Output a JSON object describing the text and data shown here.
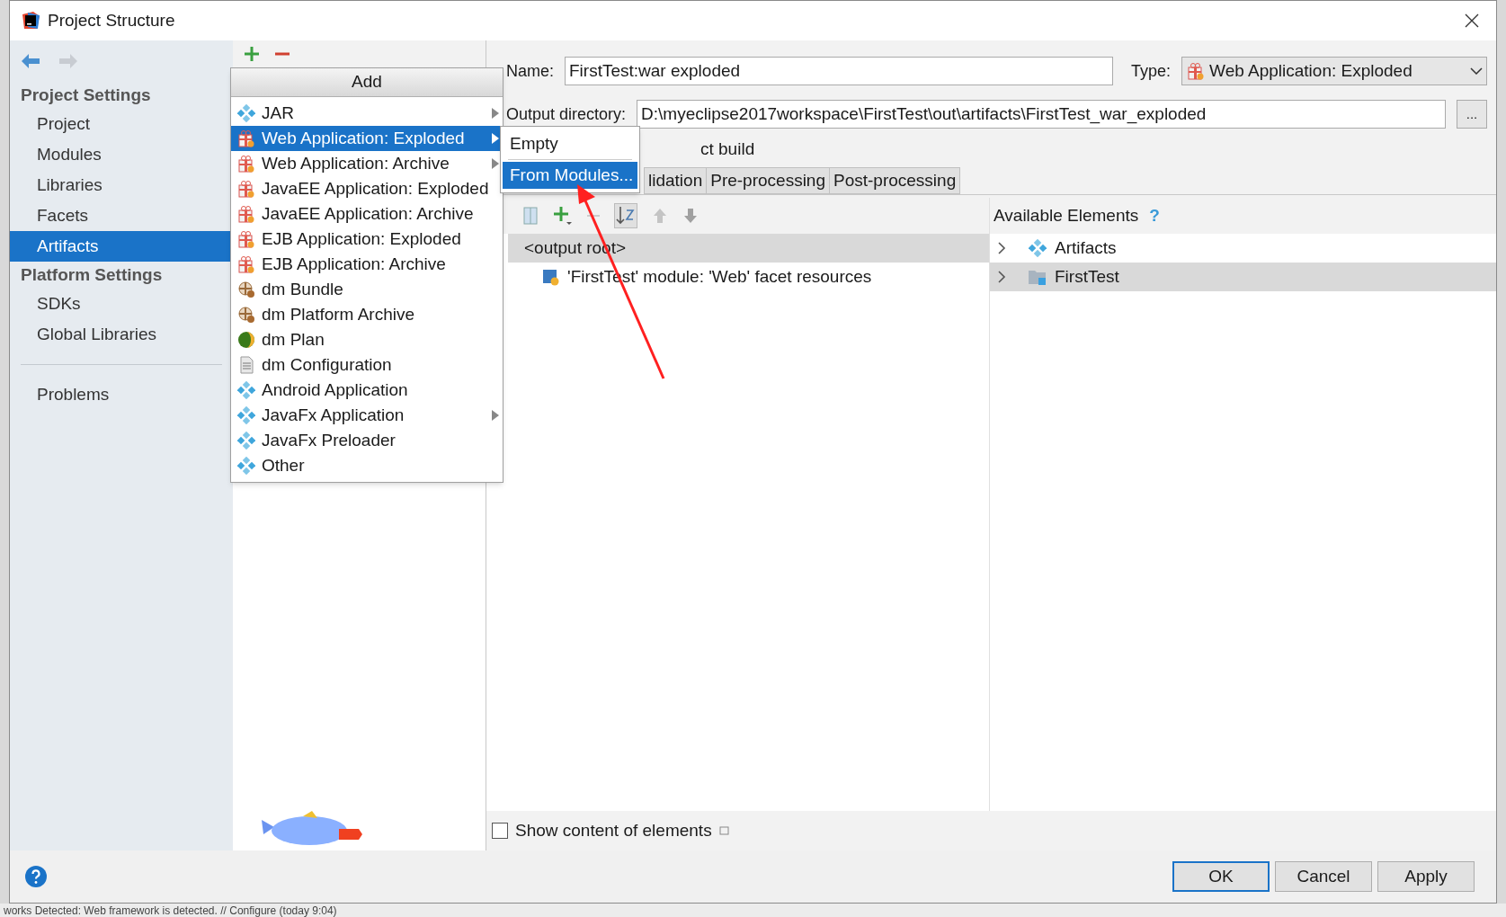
{
  "window": {
    "title": "Project Structure"
  },
  "sidebar": {
    "sections": [
      {
        "heading": "Project Settings",
        "items": [
          {
            "label": "Project",
            "selected": false
          },
          {
            "label": "Modules",
            "selected": false
          },
          {
            "label": "Libraries",
            "selected": false
          },
          {
            "label": "Facets",
            "selected": false
          },
          {
            "label": "Artifacts",
            "selected": true
          }
        ]
      },
      {
        "heading": "Platform Settings",
        "items": [
          {
            "label": "SDKs",
            "selected": false
          },
          {
            "label": "Global Libraries",
            "selected": false
          }
        ]
      }
    ],
    "extra_items": [
      {
        "label": "Problems",
        "selected": false
      }
    ]
  },
  "add_menu": {
    "title": "Add",
    "items": [
      {
        "label": "JAR",
        "kind": "diamond",
        "selected": false,
        "submenu": true
      },
      {
        "label": "Web Application: Exploded",
        "kind": "gift",
        "selected": true,
        "submenu": true
      },
      {
        "label": "Web Application: Archive",
        "kind": "gift",
        "selected": false,
        "submenu": true
      },
      {
        "label": "JavaEE Application: Exploded",
        "kind": "gift",
        "selected": false,
        "submenu": false
      },
      {
        "label": "JavaEE Application: Archive",
        "kind": "gift",
        "selected": false,
        "submenu": false
      },
      {
        "label": "EJB Application: Exploded",
        "kind": "gift",
        "selected": false,
        "submenu": false
      },
      {
        "label": "EJB Application: Archive",
        "kind": "gift",
        "selected": false,
        "submenu": false
      },
      {
        "label": "dm Bundle",
        "kind": "bundle",
        "selected": false,
        "submenu": false
      },
      {
        "label": "dm Platform Archive",
        "kind": "bundle",
        "selected": false,
        "submenu": false
      },
      {
        "label": "dm Plan",
        "kind": "plan",
        "selected": false,
        "submenu": false
      },
      {
        "label": "dm Configuration",
        "kind": "doc",
        "selected": false,
        "submenu": false
      },
      {
        "label": "Android Application",
        "kind": "diamond",
        "selected": false,
        "submenu": false
      },
      {
        "label": "JavaFx Application",
        "kind": "diamond",
        "selected": false,
        "submenu": true
      },
      {
        "label": "JavaFx Preloader",
        "kind": "diamond",
        "selected": false,
        "submenu": false
      },
      {
        "label": "Other",
        "kind": "diamond",
        "selected": false,
        "submenu": false
      }
    ]
  },
  "submenu": {
    "items": [
      {
        "label": "Empty",
        "selected": false
      },
      {
        "label": "From Modules...",
        "selected": true
      }
    ]
  },
  "artifact": {
    "name_label": "Name:",
    "name": "FirstTest:war exploded",
    "type_label": "Type:",
    "type": "Web Application: Exploded",
    "output_label": "Output directory:",
    "output": "D:\\myeclipse2017workspace\\FirstTest\\out\\artifacts\\FirstTest_war_exploded",
    "browse": "...",
    "build_label": "ct build"
  },
  "tabs": [
    {
      "label": "lidation",
      "selected": false
    },
    {
      "label": "Pre-processing",
      "selected": false
    },
    {
      "label": "Post-processing",
      "selected": false
    }
  ],
  "layout_tree": [
    {
      "label": "<output root>",
      "selected": true,
      "children": [
        {
          "label": "'FirstTest' module: 'Web' facet resources",
          "selected": false
        }
      ]
    }
  ],
  "available": {
    "title": "Available Elements",
    "help": "?",
    "items": [
      {
        "label": "Artifacts",
        "kind": "diamond",
        "selected": false
      },
      {
        "label": "FirstTest",
        "kind": "folder",
        "selected": true
      }
    ]
  },
  "show_content": {
    "label": "Show content of elements",
    "checked": false
  },
  "buttons": [
    {
      "label": "OK",
      "kind": "default"
    },
    {
      "label": "Cancel",
      "kind": "normal"
    },
    {
      "label": "Apply",
      "kind": "normal"
    }
  ],
  "status_bar": {
    "text": "works Detected: Web framework is detected. // Configure (today 9:04)"
  }
}
